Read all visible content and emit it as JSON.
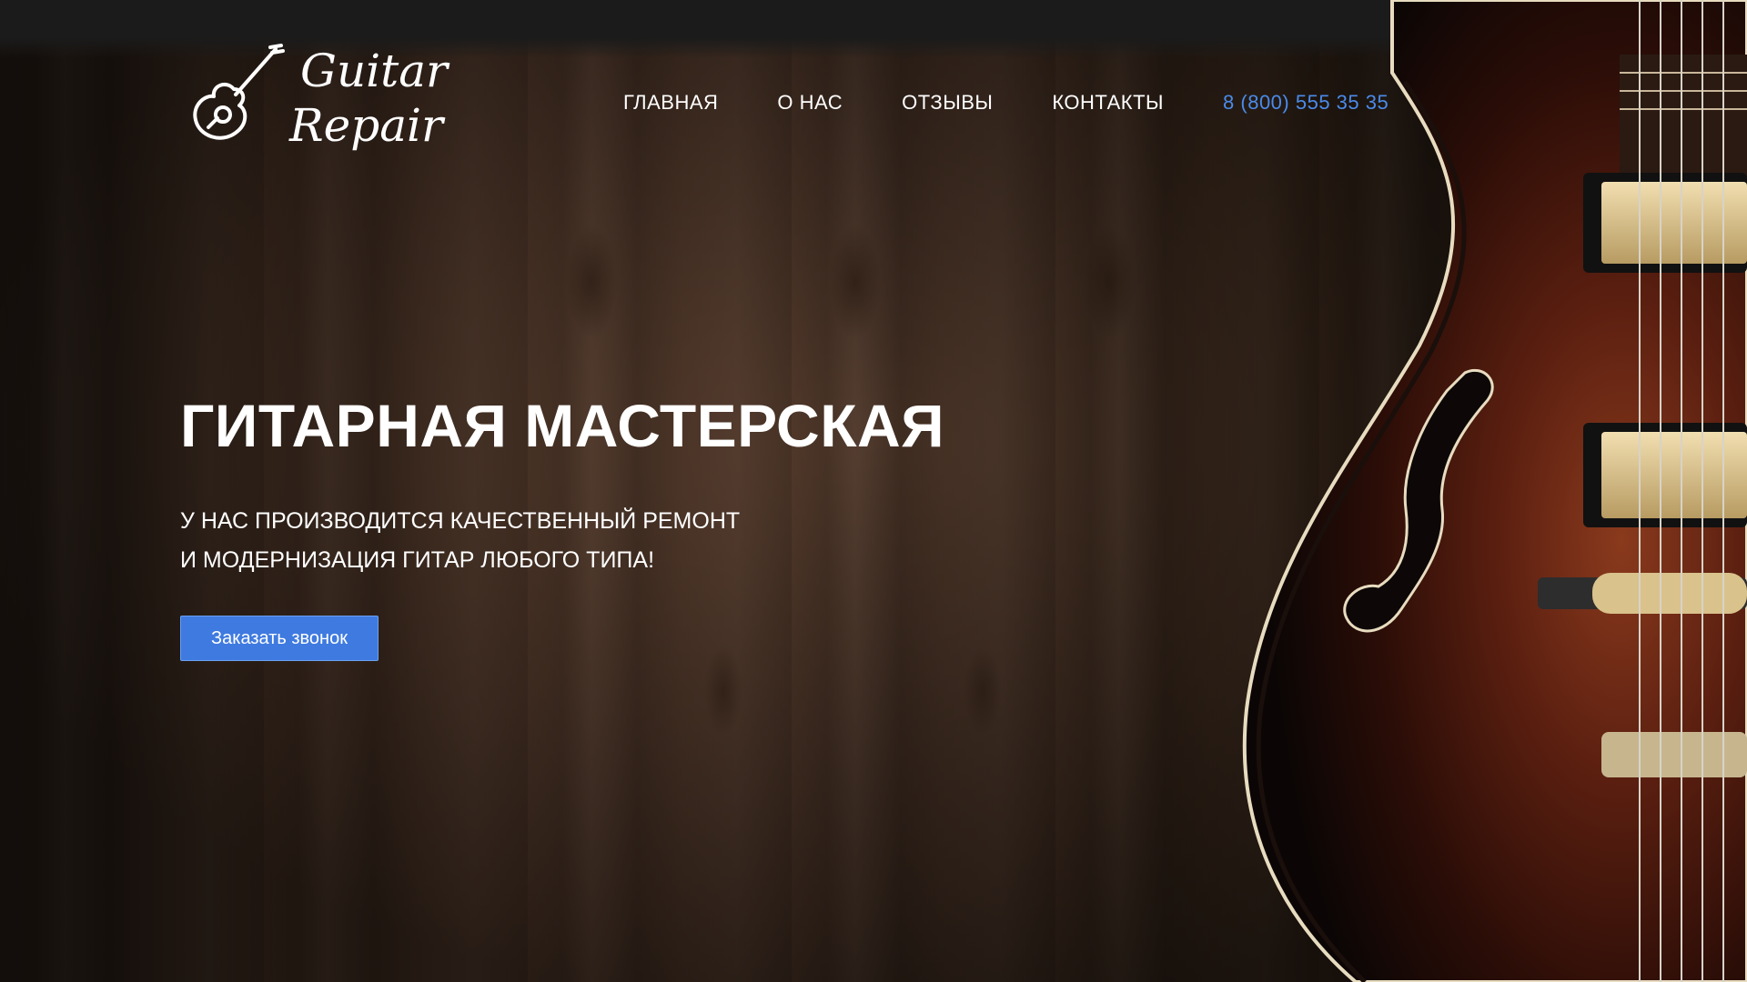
{
  "brand": {
    "logo_line1": "Guitar",
    "logo_line2": "Repair"
  },
  "nav": {
    "items": [
      {
        "label": "ГЛАВНАЯ"
      },
      {
        "label": "О НАС"
      },
      {
        "label": "ОТЗЫВЫ"
      },
      {
        "label": "КОНТАКТЫ"
      }
    ],
    "phone": "8 (800) 555 35 35"
  },
  "hero": {
    "title": "ГИТАРНАЯ МАСТЕРСКАЯ",
    "subtitle_line1": "У НАС ПРОИЗВОДИТСЯ КАЧЕСТВЕННЫЙ РЕМОНТ",
    "subtitle_line2": "И МОДЕРНИЗАЦИЯ ГИТАР ЛЮБОГО ТИПА!",
    "cta_label": "Заказать звонок"
  },
  "colors": {
    "accent": "#4a8bea",
    "button": "#3f7ae0",
    "header_bg": "#1b1b1b",
    "text": "#ffffff"
  },
  "icons": {
    "logo": "acoustic-guitar-icon"
  }
}
